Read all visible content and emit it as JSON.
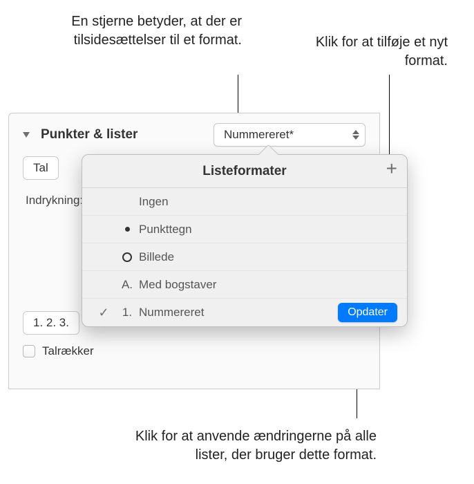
{
  "callouts": {
    "asterisk": "En stjerne betyder, at der er tilsidesættelser til et format.",
    "add": "Klik for at tilføje et nyt format.",
    "update": "Klik for at anvende ændringerne på alle lister, der bruger dette format."
  },
  "panel": {
    "section_title": "Punkter & lister",
    "style_dropdown": "Nummereret*",
    "type_dropdown": "Tal",
    "indent_label": "Indrykning:",
    "numbering_example": "1. 2. 3.",
    "checkbox_label": "Talrækker"
  },
  "popover": {
    "title": "Listeformater",
    "plus": "+",
    "update_button": "Opdater",
    "items": [
      {
        "prefix_type": "none",
        "prefix": "",
        "label": "Ingen",
        "checked": false,
        "action": false
      },
      {
        "prefix_type": "dot",
        "prefix": "",
        "label": "Punkttegn",
        "checked": false,
        "action": false
      },
      {
        "prefix_type": "ring",
        "prefix": "",
        "label": "Billede",
        "checked": false,
        "action": false
      },
      {
        "prefix_type": "text",
        "prefix": "A.",
        "label": "Med bogstaver",
        "checked": false,
        "action": false
      },
      {
        "prefix_type": "text",
        "prefix": "1.",
        "label": "Nummereret",
        "checked": true,
        "action": true
      }
    ]
  }
}
